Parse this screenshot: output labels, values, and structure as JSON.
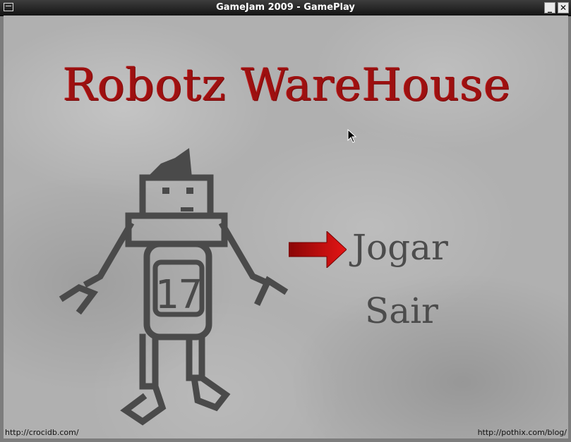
{
  "window": {
    "title": "GameJam 2009 - GamePlay",
    "icon": "window-menu-icon",
    "minimize_label": "_",
    "close_label": "✕"
  },
  "game": {
    "title": "Robotz WareHouse",
    "title_color": "#9d1010",
    "robot_number": "17",
    "menu": {
      "items": [
        {
          "label": "Jogar",
          "selected": true
        },
        {
          "label": "Sair",
          "selected": false
        }
      ],
      "selector_icon": "red-arrow-icon"
    }
  },
  "credits": {
    "left": "http://crocidb.com/",
    "right": "http://pothix.com/blog/"
  },
  "colors": {
    "background": "#b0b0b0",
    "menu_text": "#4c4c4c",
    "robot_stroke": "#4a4a4a",
    "arrow": "#c41010"
  }
}
